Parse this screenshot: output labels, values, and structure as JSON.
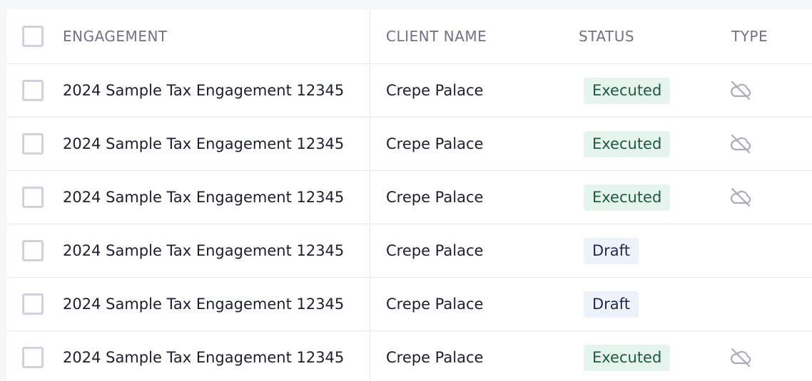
{
  "columns": {
    "engagement": "ENGAGEMENT",
    "client_name": "CLIENT NAME",
    "status": "STATUS",
    "type": "TYPE"
  },
  "colors": {
    "executed_bg": "#e6f4ee",
    "executed_text": "#1d5a3e",
    "draft_bg": "#eef3fb",
    "draft_text": "#1f2b4d",
    "header_text": "#6e7385"
  },
  "rows": [
    {
      "engagement": "2024 Sample Tax Engagement 12345",
      "client_name": "Crepe Palace",
      "status": "Executed",
      "type_icon": "cloud-off-icon"
    },
    {
      "engagement": "2024 Sample Tax Engagement 12345",
      "client_name": "Crepe Palace",
      "status": "Executed",
      "type_icon": "cloud-off-icon"
    },
    {
      "engagement": "2024 Sample Tax Engagement 12345",
      "client_name": "Crepe Palace",
      "status": "Executed",
      "type_icon": "cloud-off-icon"
    },
    {
      "engagement": "2024 Sample Tax Engagement 12345",
      "client_name": "Crepe Palace",
      "status": "Draft",
      "type_icon": ""
    },
    {
      "engagement": "2024 Sample Tax Engagement 12345",
      "client_name": "Crepe Palace",
      "status": "Draft",
      "type_icon": ""
    },
    {
      "engagement": "2024 Sample Tax Engagement 12345",
      "client_name": "Crepe Palace",
      "status": "Executed",
      "type_icon": "cloud-off-icon"
    }
  ]
}
